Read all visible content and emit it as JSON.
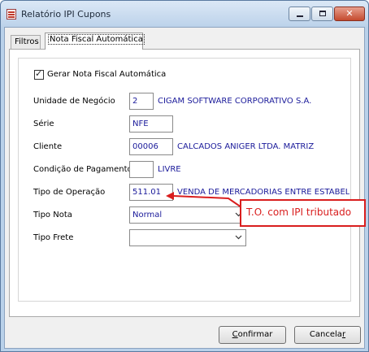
{
  "window": {
    "title": "Relatório IPI Cupons",
    "minimize_glyph": "",
    "maximize_glyph": "",
    "close_glyph": "✕"
  },
  "tabs": [
    {
      "label": "Filtros"
    },
    {
      "label": "Nota Fiscal Automática"
    }
  ],
  "form": {
    "checkbox_label": "Gerar Nota Fiscal Automática",
    "checkbox_checked": true,
    "fields": {
      "unidade": {
        "label": "Unidade de Negócio",
        "value": "2",
        "description": "CIGAM SOFTWARE CORPORATIVO S.A."
      },
      "serie": {
        "label": "Série",
        "value": "NFE"
      },
      "cliente": {
        "label": "Cliente",
        "value": "00006",
        "description": "CALCADOS ANIGER LTDA. MATRIZ"
      },
      "condicao": {
        "label": "Condição de Pagamento",
        "value": "",
        "description": "LIVRE"
      },
      "tipo_operacao": {
        "label": "Tipo de Operação",
        "value": "511.01",
        "description": "VENDA DE MERCADORIAS ENTRE ESTABELEC"
      },
      "tipo_nota": {
        "label": "Tipo Nota",
        "value": "Normal"
      },
      "tipo_frete": {
        "label": "Tipo Frete",
        "value": ""
      }
    }
  },
  "annotation": {
    "text": "T.O. com IPI tributado",
    "color": "#d91e1e"
  },
  "buttons": {
    "confirm": {
      "first": "C",
      "rest": "onfirmar"
    },
    "cancel": {
      "first": "Cancela",
      "underlined": "r"
    }
  }
}
